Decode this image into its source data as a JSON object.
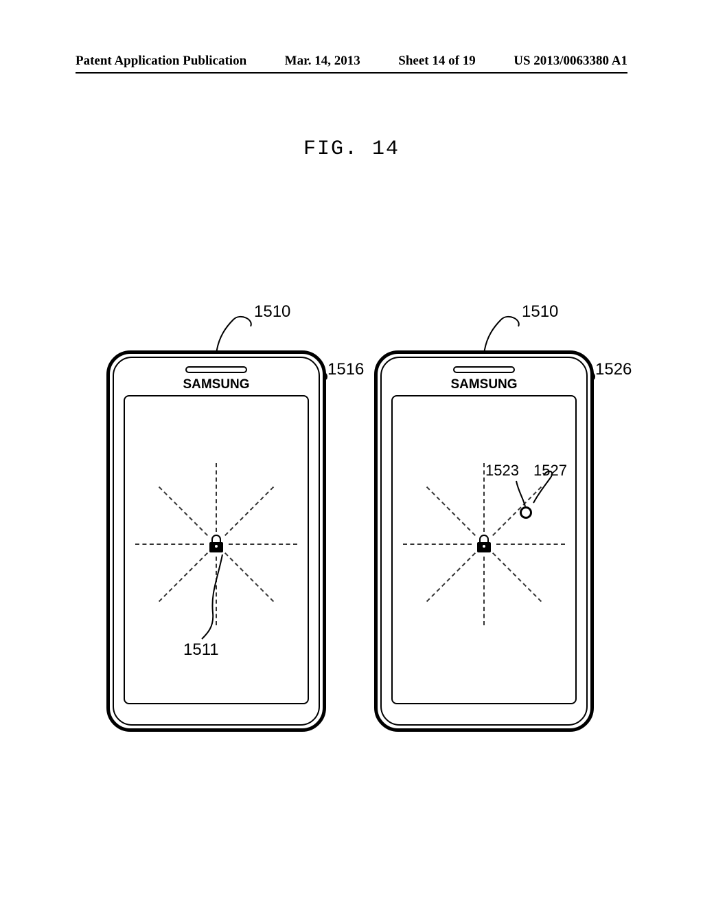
{
  "header": {
    "pubType": "Patent Application Publication",
    "date": "Mar. 14, 2013",
    "sheet": "Sheet 14 of 19",
    "pubNumber": "US 2013/0063380 A1"
  },
  "figureLabel": "FIG. 14",
  "brand": "SAMSUNG",
  "refs": {
    "phoneLeft": "1510",
    "phoneRight": "1510",
    "screenLeft": "1516",
    "screenRight": "1526",
    "lockLeft": "1511",
    "touchLabel": "1523",
    "touchRef": "1527"
  }
}
